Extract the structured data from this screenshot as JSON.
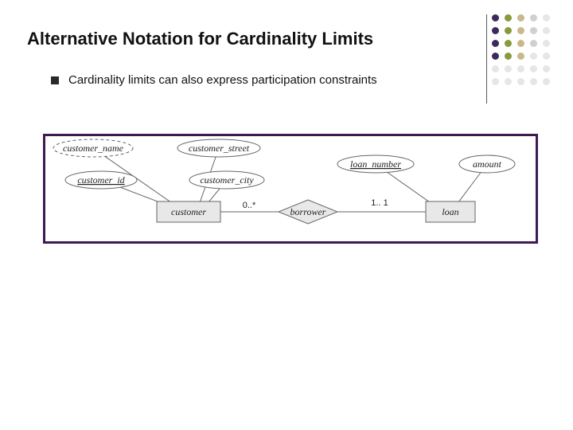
{
  "slide": {
    "title": "Alternative Notation for Cardinality Limits",
    "bullet": "Cardinality limits can also express participation constraints"
  },
  "diagram": {
    "entities": {
      "customer": "customer",
      "loan": "loan"
    },
    "relationship": "borrower",
    "attributes": {
      "customer_name": "customer_name",
      "customer_id": "customer_id",
      "customer_street": "customer_street",
      "customer_city": "customer_city",
      "loan_number": "loan_number",
      "amount": "amount"
    },
    "cardinality": {
      "left": "0..*",
      "right": "1.. 1"
    }
  },
  "deco_colors": {
    "purple": "#3d2a5a",
    "olive": "#8a9a3a",
    "tan": "#c9b98a",
    "grayd": "#d0d0d0",
    "graye": "#e6e6e6"
  }
}
